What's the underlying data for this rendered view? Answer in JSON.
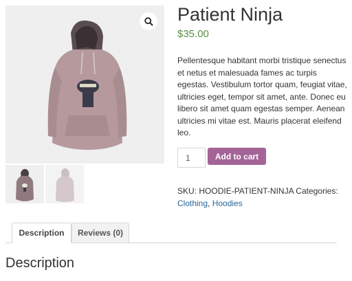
{
  "product": {
    "title": "Patient Ninja",
    "price": "$35.00",
    "description": "Pellentesque habitant morbi tristique senectus et netus et malesuada fames ac turpis egestas. Vestibulum tortor quam, feugiat vitae, ultricies eget, tempor sit amet, ante. Donec eu libero sit amet quam egestas semper. Aenean ultricies mi vitae est. Mauris placerat eleifend leo."
  },
  "cart": {
    "quantity": "1",
    "add_label": "Add to cart"
  },
  "meta": {
    "sku_label": "SKU:",
    "sku_value": "HOODIE-PATIENT-NINJA",
    "categories_label": "Categories:",
    "categories": [
      "Clothing",
      "Hoodies"
    ],
    "separator": ","
  },
  "tabs": [
    {
      "label": "Description"
    },
    {
      "label": "Reviews (0)"
    }
  ],
  "section": {
    "title": "Description"
  },
  "colors": {
    "accent": "#a46497",
    "price": "#5a8f45",
    "link": "#2a6496"
  },
  "icons": {
    "zoom": "magnifier-icon"
  }
}
